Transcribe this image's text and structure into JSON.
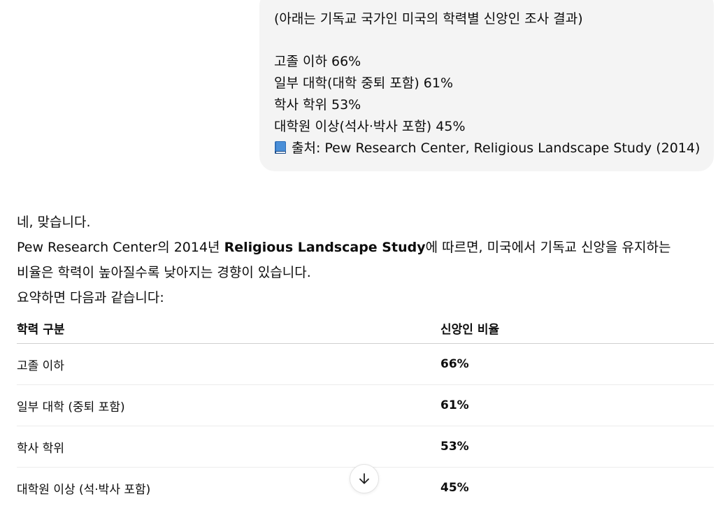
{
  "user_message": {
    "intro": "(아래는 기독교 국가인 미국의 학력별 신앙인 조사 결과)",
    "lines": [
      "고졸 이하 66%",
      "일부 대학(대학 중퇴 포함) 61%",
      "학사 학위 53%",
      "대학원 이상(석사·박사 포함) 45%"
    ],
    "source_icon": "blue-book-icon",
    "source": "출처: Pew Research Center, Religious Landscape Study (2014)"
  },
  "assistant": {
    "line1": "네, 맞습니다.",
    "line2_pre": "Pew Research Center의 2014년 ",
    "line2_bold": "Religious Landscape Study",
    "line2_post": "에 따르면, 미국에서 기독교 신앙을 유지하는",
    "line3": "비율은 학력이 높아질수록 낮아지는 경향이 있습니다.",
    "line4": "요약하면 다음과 같습니다:",
    "table": {
      "headers": [
        "학력 구분",
        "신앙인 비율"
      ],
      "rows": [
        [
          "고졸 이하",
          "66%"
        ],
        [
          "일부 대학 (중퇴 포함)",
          "61%"
        ],
        [
          "학사 학위",
          "53%"
        ],
        [
          "대학원 이상 (석·박사 포함)",
          "45%"
        ]
      ]
    }
  },
  "scroll_button": {
    "icon": "arrow-down-icon"
  },
  "colors": {
    "bubble_bg": "#f4f4f4",
    "text": "#0d0d0d",
    "book_blue": "#2f6fb8"
  }
}
